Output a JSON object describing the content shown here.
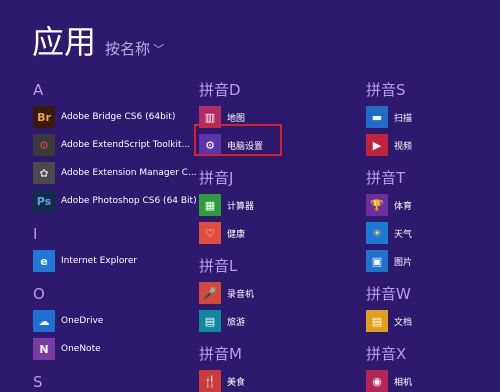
{
  "header": {
    "title": "应用",
    "sort_label": "按名称"
  },
  "col1": {
    "groups": [
      {
        "letter": "A",
        "items": [
          {
            "label": "Adobe Bridge CS6 (64bit)",
            "icon": "bridge-icon",
            "glyph": "Br",
            "color": "#3a1a0a",
            "fg": "#e8a54b"
          },
          {
            "label": "Adobe ExtendScript Toolkit...",
            "icon": "extendscript-icon",
            "glyph": "⚙",
            "color": "#3a3a3a",
            "fg": "#d04848"
          },
          {
            "label": "Adobe Extension Manager C...",
            "icon": "extension-manager-icon",
            "glyph": "✿",
            "color": "#4a4a4a",
            "fg": "#cccccc"
          },
          {
            "label": "Adobe Photoshop CS6 (64 Bit)",
            "icon": "photoshop-icon",
            "glyph": "Ps",
            "color": "#0f2d4a",
            "fg": "#5aa6e6"
          }
        ]
      },
      {
        "letter": "I",
        "items": [
          {
            "label": "Internet Explorer",
            "icon": "ie-icon",
            "glyph": "e",
            "color": "#1e78d4",
            "fg": "#ffffff"
          }
        ]
      },
      {
        "letter": "O",
        "items": [
          {
            "label": "OneDrive",
            "icon": "onedrive-icon",
            "glyph": "☁",
            "color": "#1d6fd1",
            "fg": "#ffffff"
          },
          {
            "label": "OneNote",
            "icon": "onenote-icon",
            "glyph": "N",
            "color": "#7a3aa3",
            "fg": "#ffffff"
          }
        ]
      },
      {
        "letter": "S",
        "items": []
      }
    ]
  },
  "col2": {
    "groups": [
      {
        "letter": "拼音D",
        "items": [
          {
            "label": "地图",
            "icon": "map-icon",
            "glyph": "▥",
            "color": "#b12c62",
            "fg": "#ffffff"
          },
          {
            "label": "电脑设置",
            "icon": "gear-icon",
            "glyph": "⚙",
            "color": "#5a34a8",
            "fg": "#ffffff"
          }
        ]
      },
      {
        "letter": "拼音J",
        "items": [
          {
            "label": "计算器",
            "icon": "calculator-icon",
            "glyph": "▦",
            "color": "#2d9d3d",
            "fg": "#ffffff"
          },
          {
            "label": "健康",
            "icon": "health-icon",
            "glyph": "♡",
            "color": "#e04e3f",
            "fg": "#ffffff"
          }
        ]
      },
      {
        "letter": "拼音L",
        "items": [
          {
            "label": "录音机",
            "icon": "microphone-icon",
            "glyph": "🎤",
            "color": "#d5493b",
            "fg": "#ffffff"
          },
          {
            "label": "旅游",
            "icon": "travel-icon",
            "glyph": "▤",
            "color": "#12889c",
            "fg": "#ffffff"
          }
        ]
      },
      {
        "letter": "拼音M",
        "items": [
          {
            "label": "美食",
            "icon": "food-icon",
            "glyph": "🍴",
            "color": "#cc3a3a",
            "fg": "#ffffff"
          }
        ]
      }
    ]
  },
  "col3": {
    "groups": [
      {
        "letter": "拼音S",
        "items": [
          {
            "label": "扫描",
            "icon": "scan-icon",
            "glyph": "▬",
            "color": "#1e6ec8",
            "fg": "#ffffff"
          },
          {
            "label": "视频",
            "icon": "video-icon",
            "glyph": "▶",
            "color": "#c2233c",
            "fg": "#ffffff"
          }
        ]
      },
      {
        "letter": "拼音T",
        "items": [
          {
            "label": "体育",
            "icon": "trophy-icon",
            "glyph": "🏆",
            "color": "#6b2fa0",
            "fg": "#ffffff"
          },
          {
            "label": "天气",
            "icon": "weather-icon",
            "glyph": "☀",
            "color": "#1c7ad4",
            "fg": "#ffd84a"
          },
          {
            "label": "图片",
            "icon": "photos-icon",
            "glyph": "▣",
            "color": "#1f73cc",
            "fg": "#ffffff"
          }
        ]
      },
      {
        "letter": "拼音W",
        "items": [
          {
            "label": "文档",
            "icon": "document-icon",
            "glyph": "▤",
            "color": "#e0a21c",
            "fg": "#ffffff"
          }
        ]
      },
      {
        "letter": "拼音X",
        "items": [
          {
            "label": "相机",
            "icon": "camera-icon",
            "glyph": "◉",
            "color": "#b32556",
            "fg": "#ffffff"
          }
        ]
      }
    ]
  }
}
